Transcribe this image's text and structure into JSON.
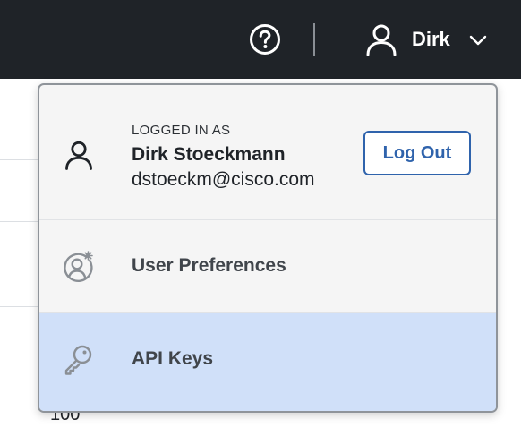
{
  "topbar": {
    "help_icon": "question-circle-icon",
    "user_icon": "user-icon",
    "user_name": "Dirk",
    "chevron_icon": "chevron-down-icon"
  },
  "background": {
    "cell_value": "100"
  },
  "dropdown": {
    "logged_in_label": "LOGGED IN AS",
    "full_name": "Dirk Stoeckmann",
    "email": "dstoeckm@cisco.com",
    "logout_label": "Log Out",
    "items": [
      {
        "label": "User Preferences",
        "icon": "user-settings-icon",
        "highlighted": false
      },
      {
        "label": "API Keys",
        "icon": "key-icon",
        "highlighted": true
      }
    ]
  },
  "colors": {
    "topbar_bg": "#1f2328",
    "accent": "#2f63ac",
    "highlight_bg": "#d0e0f9",
    "menu_bg": "#f5f5f5"
  }
}
